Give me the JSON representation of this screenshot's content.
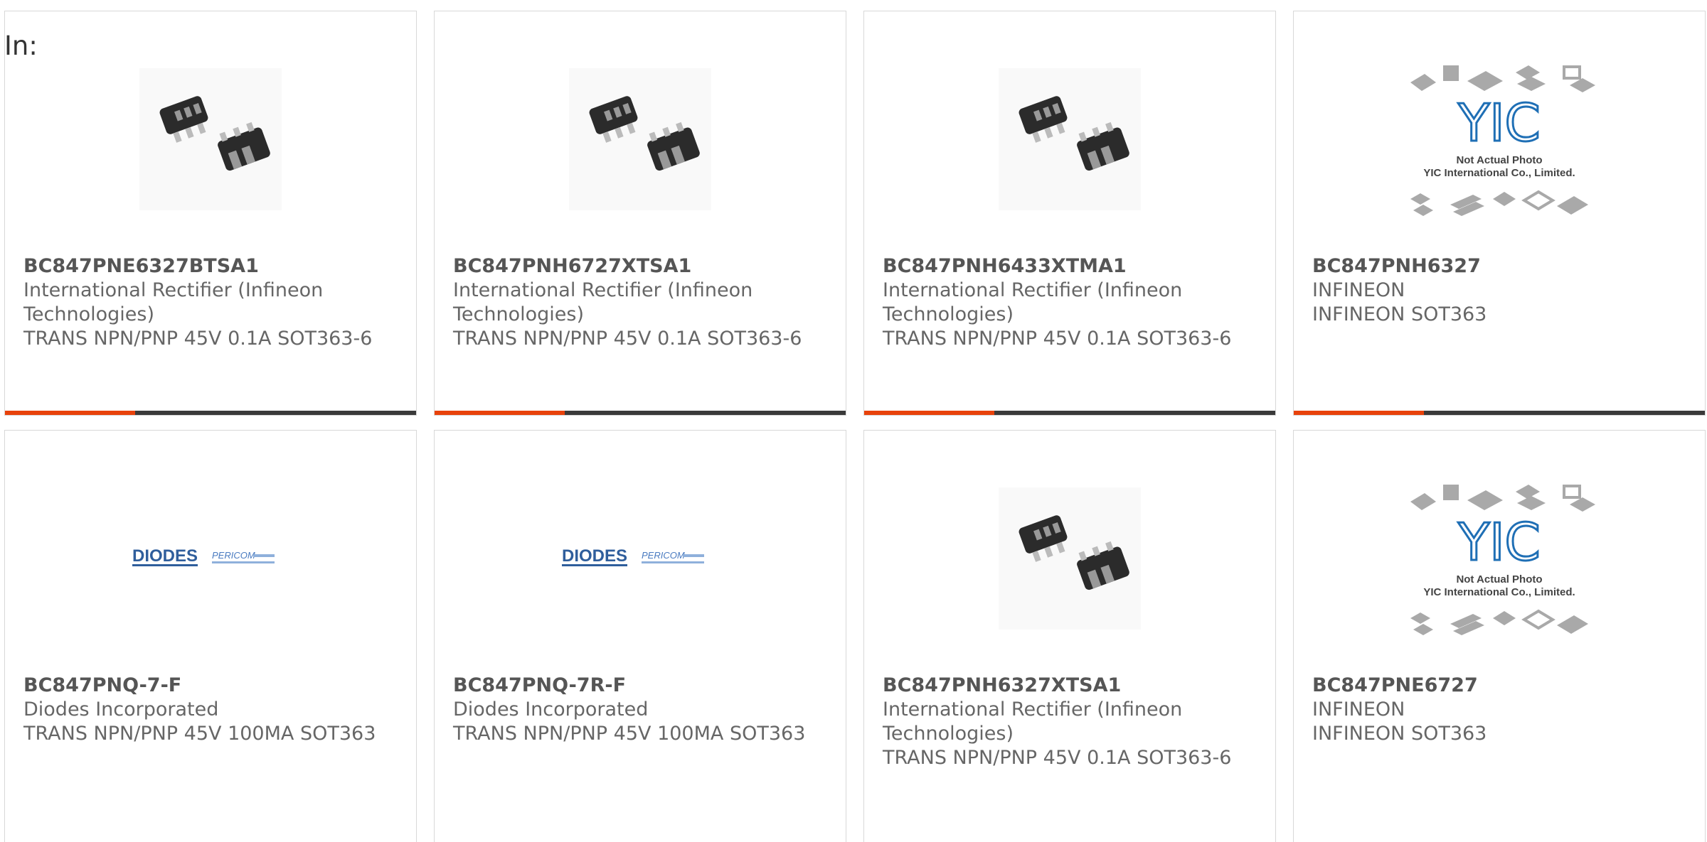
{
  "header": {
    "label": "In:"
  },
  "colors": {
    "accent": "#e8420b",
    "bar": "#3a3a3a",
    "border": "#d8d8d8",
    "text": "#666666"
  },
  "products": [
    {
      "part": "BC847PNE6327BTSA1",
      "maker": "International Rectifier (Infineon Technologies)",
      "desc": "TRANS NPN/PNP 45V 0.1A SOT363-6",
      "image": "sot363-package-photo"
    },
    {
      "part": "BC847PNH6727XTSA1",
      "maker": "International Rectifier (Infineon Technologies)",
      "desc": "TRANS NPN/PNP 45V 0.1A SOT363-6",
      "image": "sot363-package-photo"
    },
    {
      "part": "BC847PNH6433XTMA1",
      "maker": "International Rectifier (Infineon Technologies)",
      "desc": "TRANS NPN/PNP 45V 0.1A SOT363-6",
      "image": "sot363-package-photo"
    },
    {
      "part": "BC847PNH6327",
      "maker": "INFINEON",
      "desc": "INFINEON SOT363",
      "image": "yic-placeholder",
      "placeholder_line1": "Not Actual Photo",
      "placeholder_line2": "YIC International Co., Limited."
    },
    {
      "part": "BC847PNQ-7-F",
      "maker": "Diodes Incorporated",
      "desc": "TRANS NPN/PNP 45V 100MA SOT363",
      "image": "diodes-logo",
      "logo_text": "DIODES",
      "logo_sub": "PERICOM"
    },
    {
      "part": "BC847PNQ-7R-F",
      "maker": "Diodes Incorporated",
      "desc": "TRANS NPN/PNP 45V 100MA SOT363",
      "image": "diodes-logo",
      "logo_text": "DIODES",
      "logo_sub": "PERICOM"
    },
    {
      "part": "BC847PNH6327XTSA1",
      "maker": "International Rectifier (Infineon Technologies)",
      "desc": "TRANS NPN/PNP 45V 0.1A SOT363-6",
      "image": "sot363-package-photo"
    },
    {
      "part": "BC847PNE6727",
      "maker": "INFINEON",
      "desc": "INFINEON SOT363",
      "image": "yic-placeholder",
      "placeholder_line1": "Not Actual Photo",
      "placeholder_line2": "YIC International Co., Limited."
    }
  ]
}
